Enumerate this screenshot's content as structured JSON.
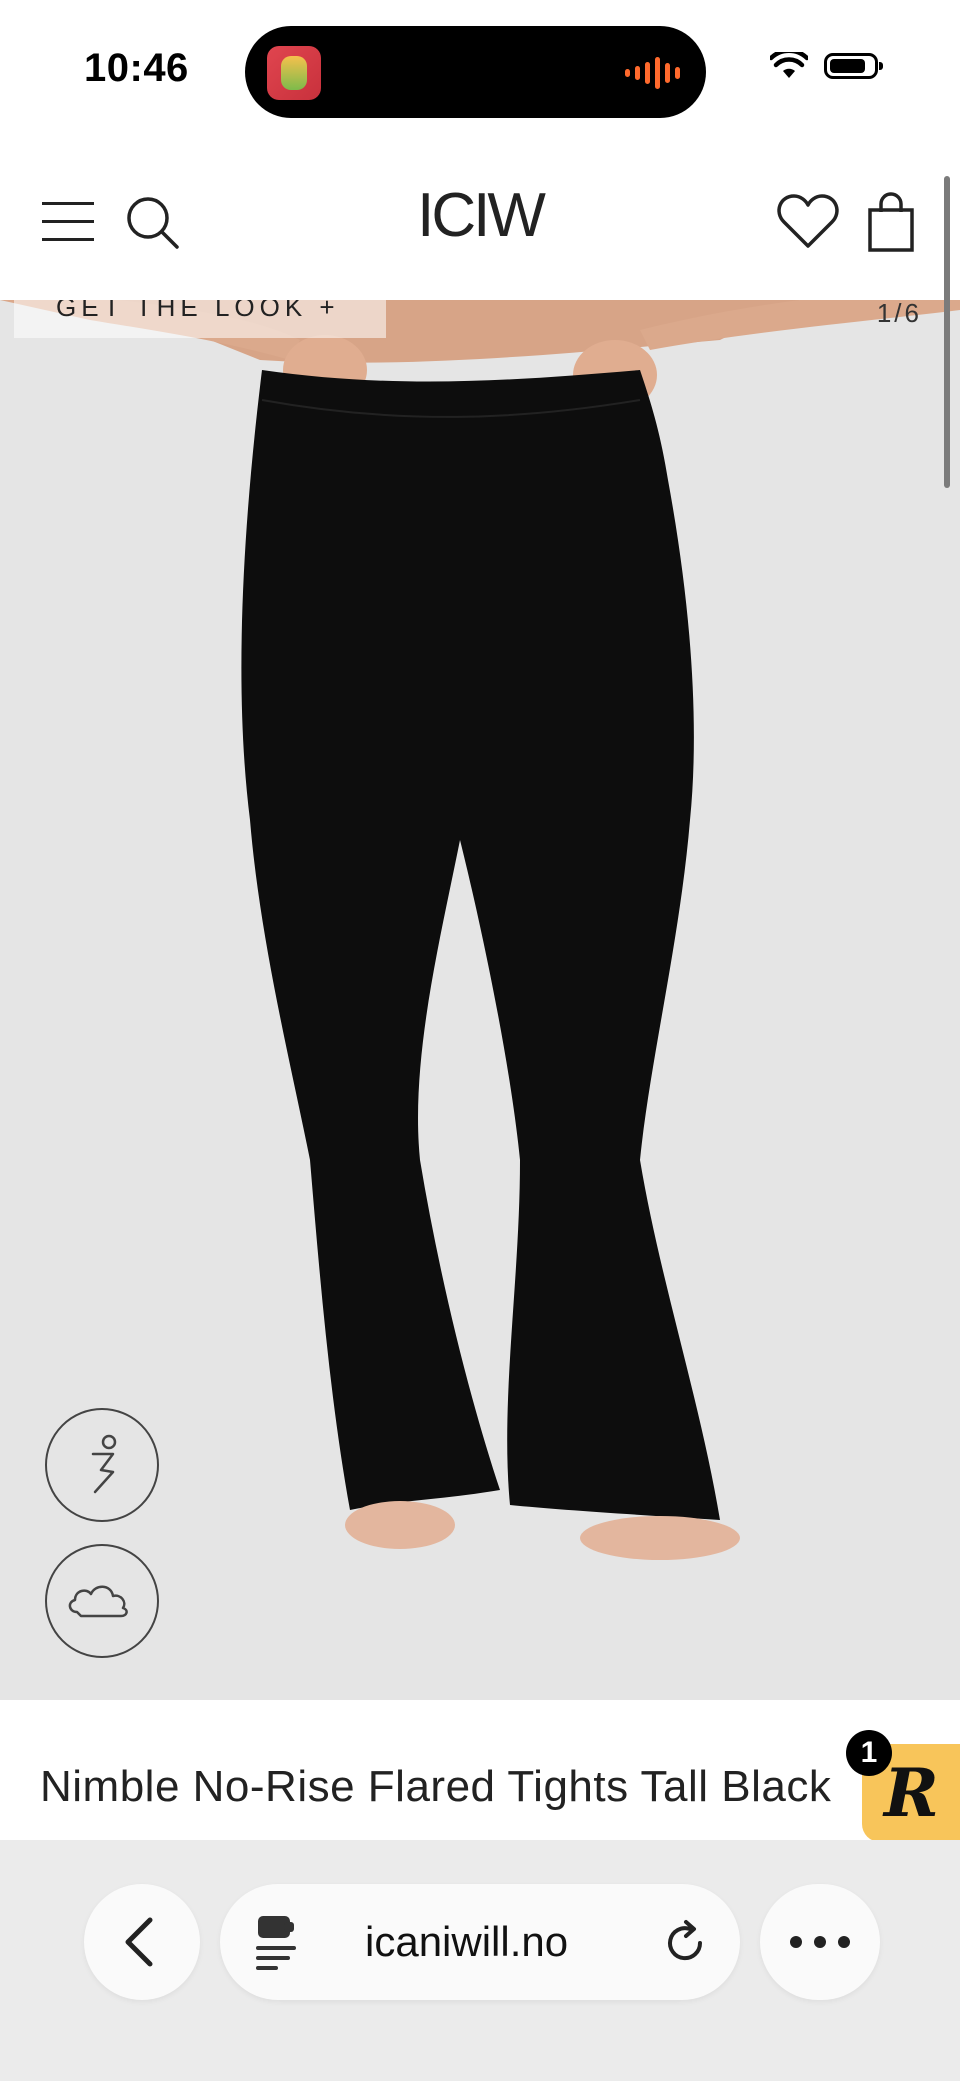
{
  "status_bar": {
    "time": "10:46"
  },
  "header": {
    "logo": "ICIW",
    "icons": [
      "menu-icon",
      "search-icon",
      "heart-icon",
      "bag-icon"
    ]
  },
  "gallery": {
    "get_the_look": "GET THE LOOK +",
    "counter": "1/6",
    "side_buttons": [
      "activity-icon",
      "weather-icon"
    ]
  },
  "product": {
    "title": "Nimble No-Rise Flared Tights Tall Black"
  },
  "reviews_badge": {
    "letter": "R",
    "count": "1"
  },
  "browser": {
    "url": "icaniwill.no"
  },
  "colors": {
    "image_background": "#e5e5e5",
    "badge": "#f8c55a",
    "browser_bar": "#ebebeb"
  }
}
